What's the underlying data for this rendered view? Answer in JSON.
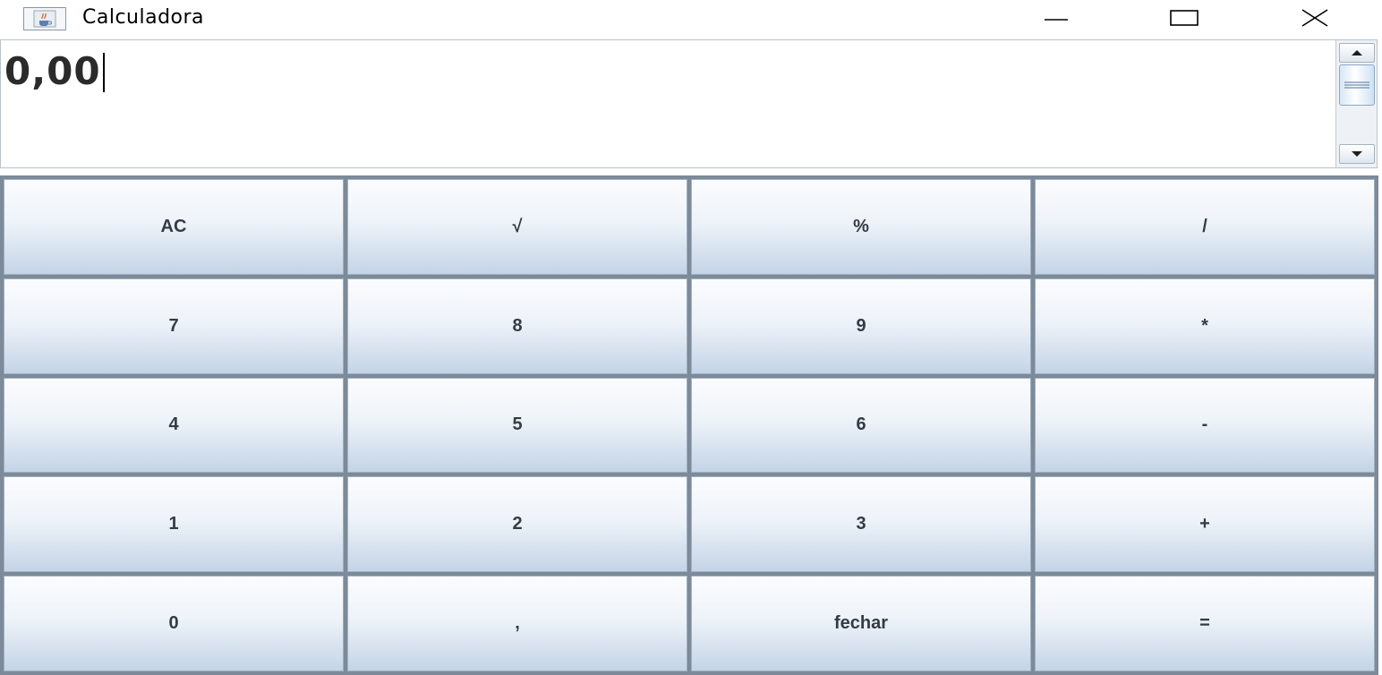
{
  "window": {
    "title": "Calculadora",
    "icons": {
      "app": "java-cup-icon",
      "minimize": "minimize-icon",
      "maximize": "maximize-icon",
      "close": "close-icon"
    }
  },
  "display": {
    "value": "0,00"
  },
  "keypad": {
    "keys": [
      "AC",
      "√",
      "%",
      "/",
      "7",
      "8",
      "9",
      "*",
      "4",
      "5",
      "6",
      "-",
      "1",
      "2",
      "3",
      "+",
      "0",
      ",",
      "fechar",
      "="
    ]
  },
  "colors": {
    "key_top": "#fbfcfe",
    "key_bottom": "#c4d4e6",
    "grid_gap": "#7c8a99",
    "key_text": "#333c46"
  }
}
